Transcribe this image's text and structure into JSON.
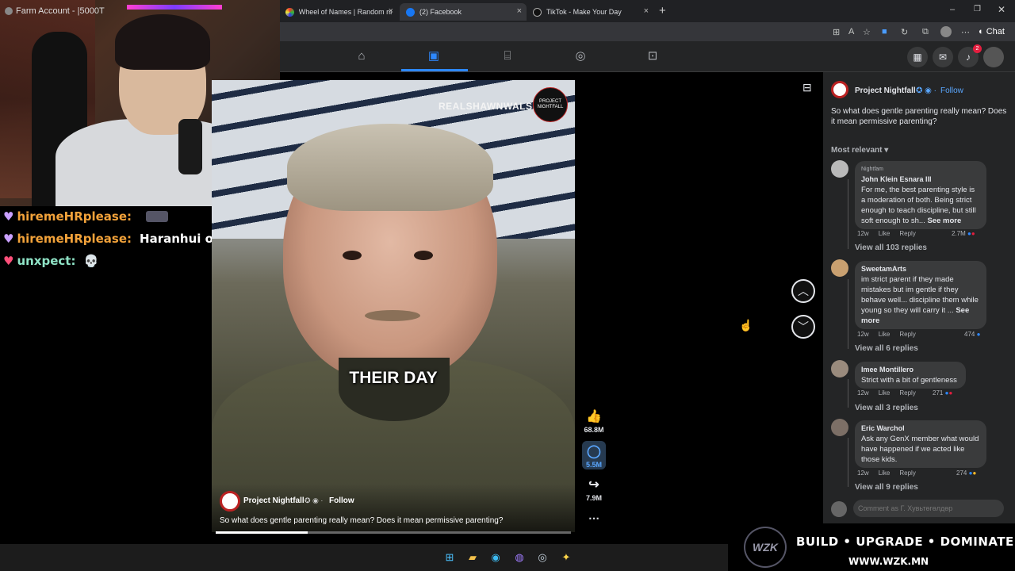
{
  "browser": {
    "tabs": [
      {
        "title": "Wheel of Names | Random name",
        "icon": "wheel-icon"
      },
      {
        "title": "(2) Facebook",
        "icon": "facebook-icon"
      },
      {
        "title": "TikTok - Make Your Day",
        "icon": "tiktok-icon"
      }
    ]
  },
  "webcam": {
    "title": "Farm Account - |5000T"
  },
  "chat": [
    {
      "user": "hiremeHRplease:",
      "message": ""
    },
    {
      "user": "hiremeHRplease:",
      "message": "Haranhui oroo"
    },
    {
      "user": "unxpect:",
      "message": "💀"
    }
  ],
  "fbnav": {
    "notifications_badge": "2"
  },
  "video": {
    "watermark": "REALSHAWNWALSH_",
    "watermark_logo": "PROJECT NIGHTFALL",
    "caption": "THEIR DAY",
    "page_name": "Project Nightfall",
    "follow": "Follow",
    "description": "So what does gentle parenting really mean? Does it mean permissive parenting?",
    "progress": 0.26
  },
  "actions": {
    "likes": "68.8M",
    "comments": "5.5M",
    "shares": "7.9M"
  },
  "panel": {
    "page_name": "Project Nightfall",
    "follow": "Follow",
    "post_text": "So what does gentle parenting really mean? Does it mean permissive parenting?",
    "sort": "Most relevant",
    "comments": [
      {
        "badge": "Nightfam",
        "name": "John Klein Esnara III",
        "text": "For me, the best parenting style is a moderation of both. Being strict enough to teach discipline, but still soft enough to sh...",
        "see_more": "See more",
        "time": "12w",
        "like": "Like",
        "reply": "Reply",
        "reactions": "2.7M",
        "view_replies": "View all 103 replies"
      },
      {
        "name": "SweetamArts",
        "text": "im strict parent if they made mistakes but im gentle if they behave well... discipline them while young so they will carry it ...",
        "see_more": "See more",
        "time": "12w",
        "like": "Like",
        "reply": "Reply",
        "reactions": "474",
        "view_replies": "View all 6 replies"
      },
      {
        "name": "Imee Montillero",
        "text": "Strict with a bit of gentleness",
        "time": "12w",
        "like": "Like",
        "reply": "Reply",
        "reactions": "271",
        "view_replies": "View all 3 replies"
      },
      {
        "name": "Eric Warchol",
        "text": "Ask any GenX member what would have happened if we acted like those kids.",
        "time": "12w",
        "like": "Like",
        "reply": "Reply",
        "reactions": "274",
        "view_replies": "View all 9 replies"
      }
    ],
    "comment_placeholder": "Comment as Г. Хувьтөгөлдөр"
  },
  "ad": {
    "logo": "WZK",
    "tagline": "BUILD • UPGRADE • DOMINATE",
    "url": "WWW.WZK.MN"
  },
  "colors": {
    "accent": "#2d88ff",
    "panel_bg": "#242526",
    "comment_bg": "#3a3b3c"
  }
}
